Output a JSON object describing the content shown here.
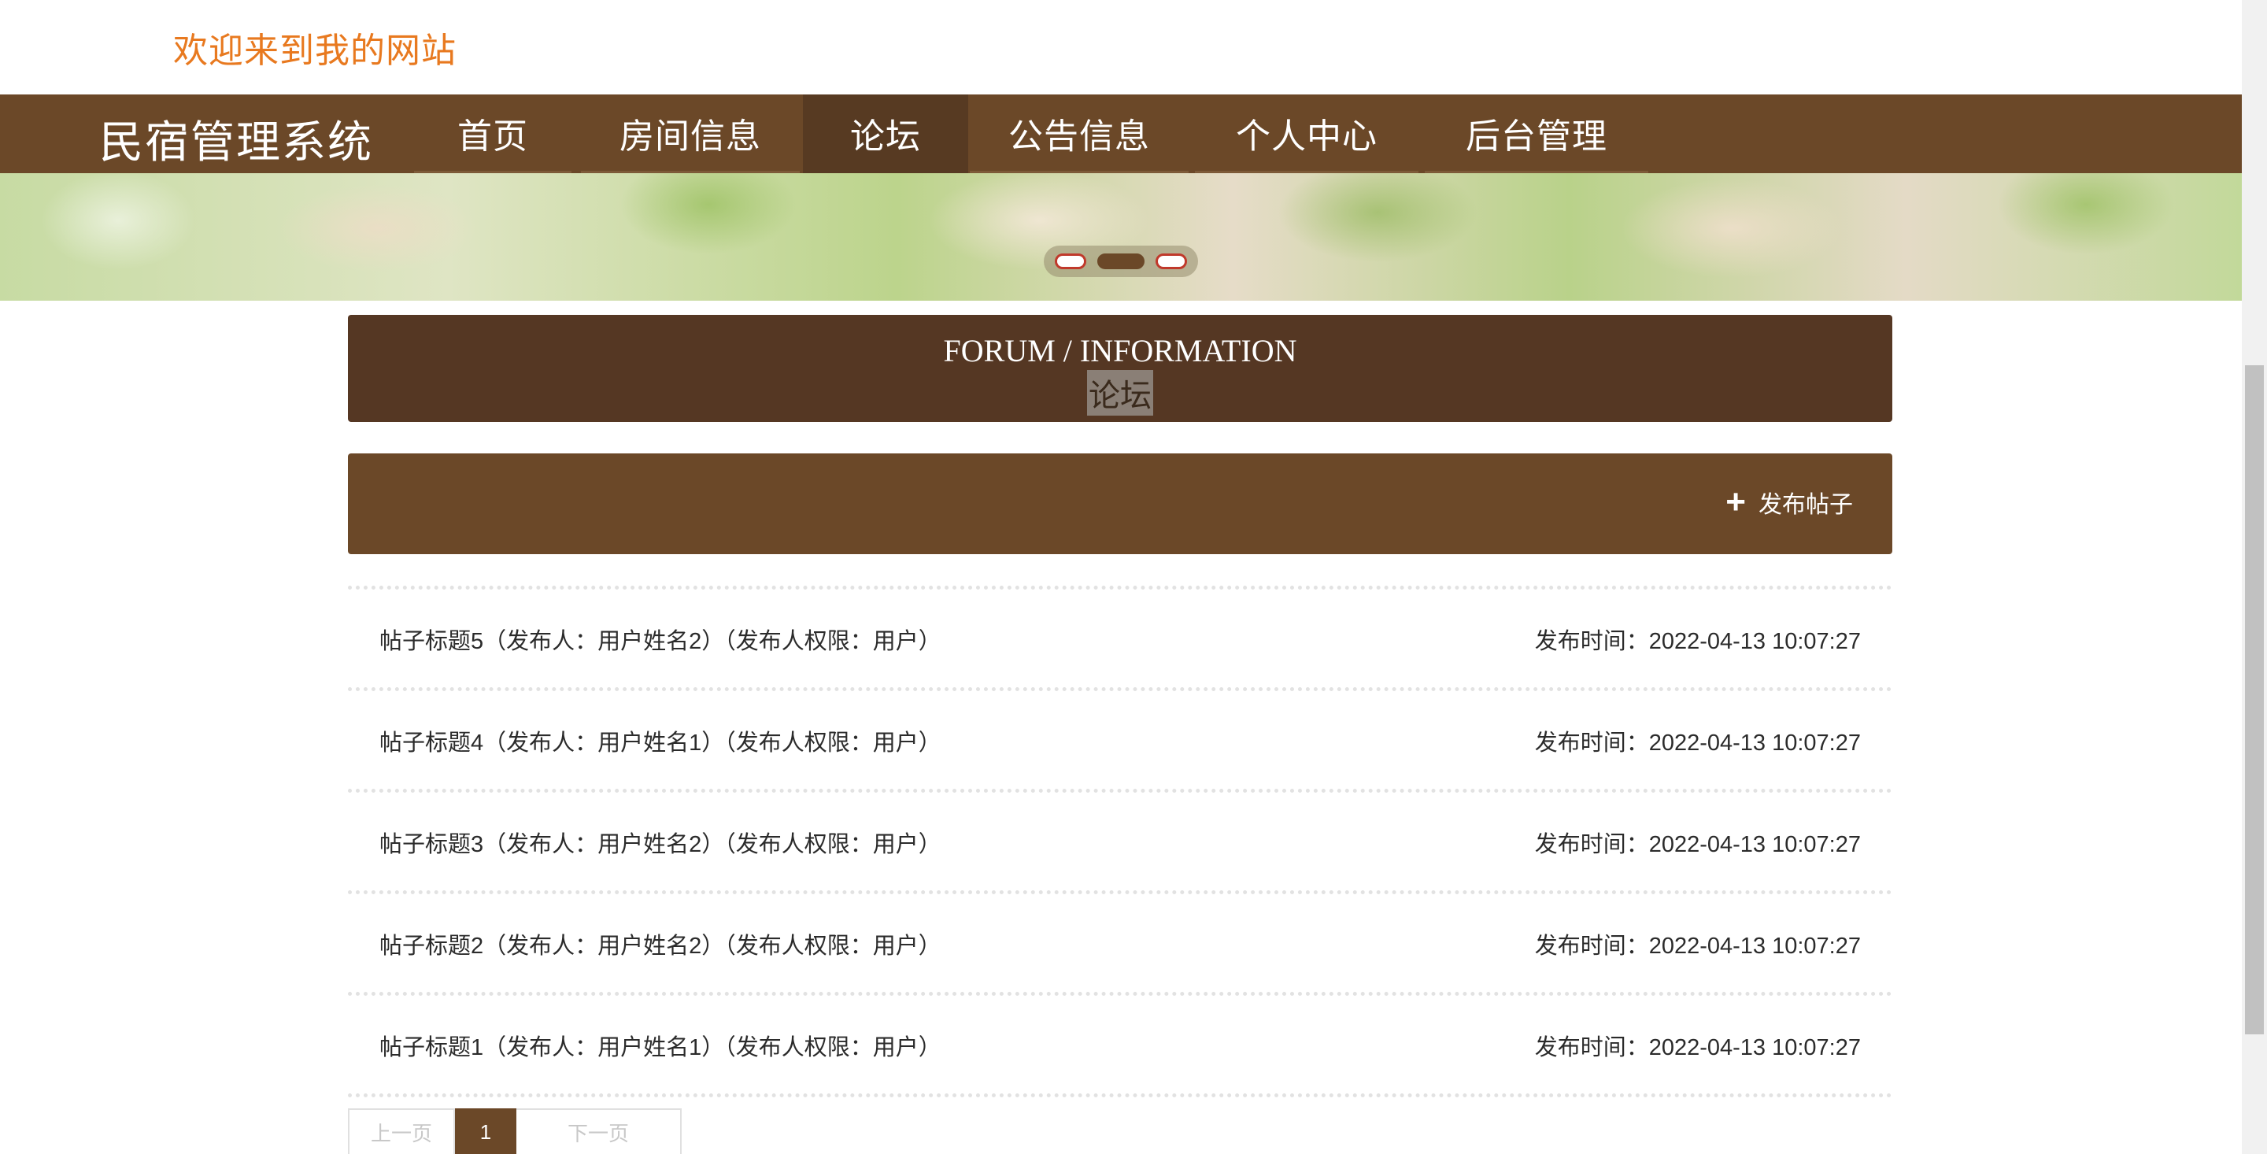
{
  "header": {
    "welcome": "欢迎来到我的网站"
  },
  "navbar": {
    "brand": "民宿管理系统",
    "items": [
      {
        "label": "首页",
        "active": false
      },
      {
        "label": "房间信息",
        "active": false
      },
      {
        "label": "论坛",
        "active": true
      },
      {
        "label": "公告信息",
        "active": false
      },
      {
        "label": "个人中心",
        "active": false
      },
      {
        "label": "后台管理",
        "active": false
      }
    ]
  },
  "banner": {
    "slide_count": 3,
    "active_slide": 2
  },
  "forum": {
    "title_en": "FORUM / INFORMATION",
    "title_cn": "论坛",
    "post_button_label": "发布帖子",
    "post_button_icon": "plus-icon"
  },
  "posts": [
    {
      "title": "帖子标题5（发布人：用户姓名2）（发布人权限：用户）",
      "time": "发布时间：2022-04-13 10:07:27"
    },
    {
      "title": "帖子标题4（发布人：用户姓名1）（发布人权限：用户）",
      "time": "发布时间：2022-04-13 10:07:27"
    },
    {
      "title": "帖子标题3（发布人：用户姓名2）（发布人权限：用户）",
      "time": "发布时间：2022-04-13 10:07:27"
    },
    {
      "title": "帖子标题2（发布人：用户姓名2）（发布人权限：用户）",
      "time": "发布时间：2022-04-13 10:07:27"
    },
    {
      "title": "帖子标题1（发布人：用户姓名1）（发布人权限：用户）",
      "time": "发布时间：2022-04-13 10:07:27"
    }
  ],
  "pagination": {
    "prev_label": "上一页",
    "current_page": "1",
    "next_label": "下一页"
  },
  "colors": {
    "welcome": "#e8791f",
    "nav_bg": "#6b4828",
    "nav_active": "#573a22",
    "forum_header_bg": "#553723"
  }
}
